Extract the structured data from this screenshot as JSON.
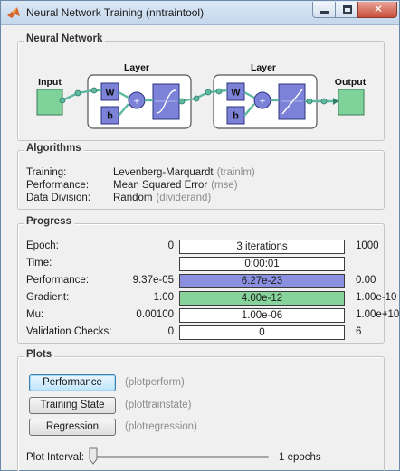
{
  "window": {
    "title": "Neural Network Training (nntraintool)"
  },
  "network": {
    "section_title": "Neural Network",
    "input_label": "Input",
    "output_label": "Output",
    "layers": [
      {
        "label": "Layer",
        "weight": "W",
        "bias": "b",
        "sum": "+"
      },
      {
        "label": "Layer",
        "weight": "W",
        "bias": "b",
        "sum": "+"
      }
    ]
  },
  "algorithms": {
    "section_title": "Algorithms",
    "rows": [
      {
        "label": "Training:",
        "value": "Levenberg-Marquardt",
        "hint": "(trainlm)"
      },
      {
        "label": "Performance:",
        "value": "Mean Squared Error",
        "hint": "(mse)"
      },
      {
        "label": "Data Division:",
        "value": "Random",
        "hint": "(dividerand)"
      }
    ]
  },
  "progress": {
    "section_title": "Progress",
    "rows": [
      {
        "label": "Epoch:",
        "start": "0",
        "current": "3 iterations",
        "end": "1000",
        "fill_fraction": 0,
        "fill_color": ""
      },
      {
        "label": "Time:",
        "start": "",
        "current": "0:00:01",
        "end": "",
        "fill_fraction": 0,
        "fill_color": ""
      },
      {
        "label": "Performance:",
        "start": "9.37e-05",
        "current": "6.27e-23",
        "end": "0.00",
        "fill_fraction": 1,
        "fill_color": "#8a8fe0"
      },
      {
        "label": "Gradient:",
        "start": "1.00",
        "current": "4.00e-12",
        "end": "1.00e-10",
        "fill_fraction": 1,
        "fill_color": "#86d39b"
      },
      {
        "label": "Mu:",
        "start": "0.00100",
        "current": "1.00e-06",
        "end": "1.00e+10",
        "fill_fraction": 0,
        "fill_color": ""
      },
      {
        "label": "Validation Checks:",
        "start": "0",
        "current": "0",
        "end": "6",
        "fill_fraction": 0,
        "fill_color": ""
      }
    ]
  },
  "plots": {
    "section_title": "Plots",
    "buttons": [
      {
        "label": "Performance",
        "hint": "(plotperform)"
      },
      {
        "label": "Training State",
        "hint": "(plottrainstate)"
      },
      {
        "label": "Regression",
        "hint": "(plotregression)"
      }
    ],
    "interval_label": "Plot Interval:",
    "interval_value": "1 epochs",
    "interval_fraction": 0
  },
  "colors": {
    "node_green": "#7fd39a",
    "block_blue": "#7b82d8",
    "link_teal": "#5fb8a0"
  }
}
